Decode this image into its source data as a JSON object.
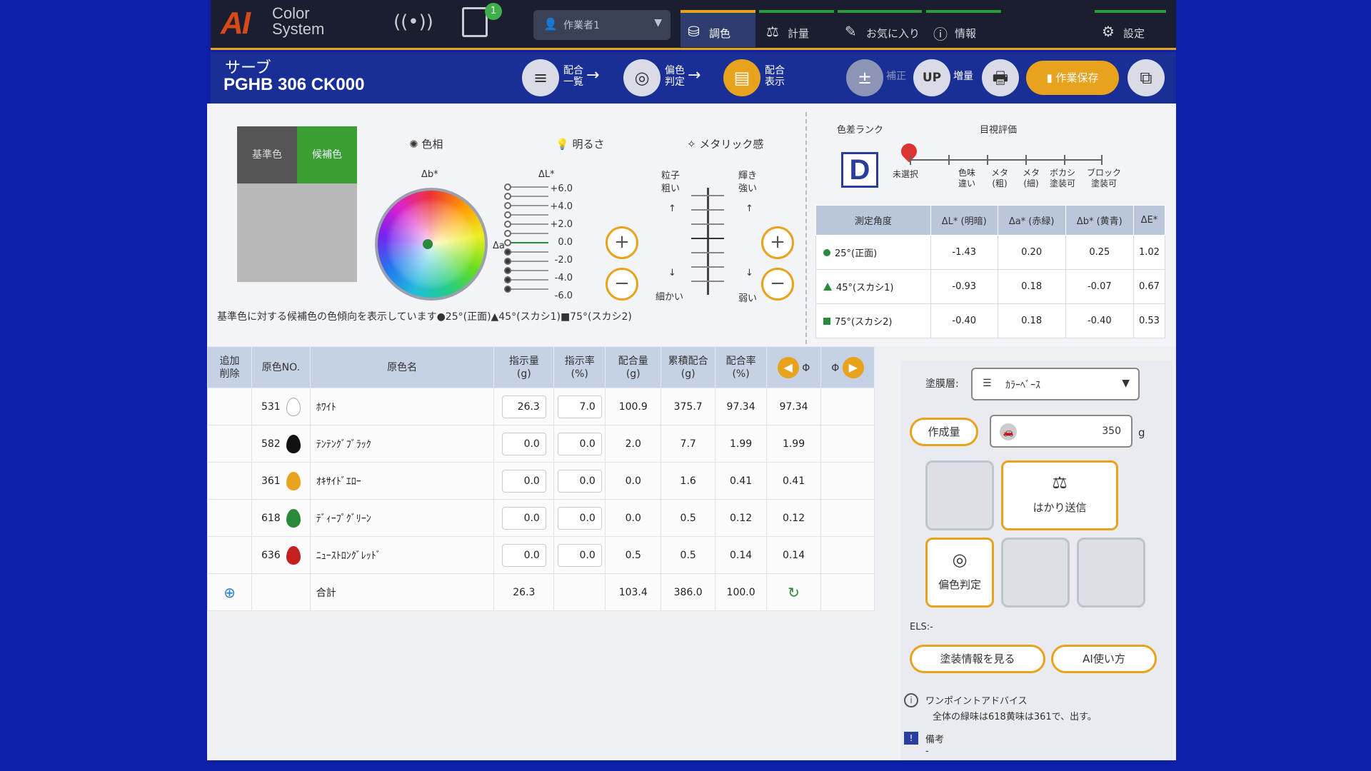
{
  "header": {
    "logo_ai": "AI",
    "logo_line1": "Color",
    "logo_line2": "System",
    "pc_badge": "1",
    "user_select": "作業者1",
    "tabs": [
      {
        "label": "調色",
        "icon": "mixing-icon"
      },
      {
        "label": "計量",
        "icon": "scale-icon"
      },
      {
        "label": "お気に入り",
        "icon": "favorite-icon"
      },
      {
        "label": "情報",
        "icon": "info-icon"
      },
      {
        "label": "設定",
        "icon": "gear-icon"
      }
    ]
  },
  "subheader": {
    "car_name": "サーブ",
    "color_code": "PGHB 306 CK000",
    "steps": [
      {
        "line1": "配合",
        "line2": "一覧"
      },
      {
        "line1": "偏色",
        "line2": "判定"
      },
      {
        "line1": "配合",
        "line2": "表示"
      }
    ],
    "correct_label": "補正",
    "increase_label": "増量",
    "up_label": "UP",
    "save_label": "作業保存"
  },
  "swatch": {
    "base_label": "基準色",
    "candidate_label": "候補色"
  },
  "sections": {
    "hue": "色相",
    "lightness": "明るさ",
    "metallic": "メタリック感",
    "delta_b": "Δb*",
    "delta_a": "Δa*",
    "delta_l": "ΔL*"
  },
  "lightness_scale": [
    "+6.0",
    "+4.0",
    "+2.0",
    "0.0",
    "-2.0",
    "-4.0",
    "-6.0"
  ],
  "metallic": {
    "grain_label": "粒子",
    "coarse": "粗い",
    "fine": "細かい",
    "shine_label": "輝き",
    "strong": "強い",
    "weak": "弱い",
    "up_arrow": "↑",
    "down_arrow": "↓"
  },
  "note": "基準色に対する候補色の色傾向を表示しています●25°(正面)▲45°(スカシ1)■75°(スカシ2)",
  "rank": {
    "title": "色差ランク",
    "value": "D",
    "eval_title": "目視評価",
    "unselected": "未選択",
    "options": [
      {
        "line1": "色味",
        "line2": "違い"
      },
      {
        "line1": "メタ",
        "line2": "(粗)"
      },
      {
        "line1": "メタ",
        "line2": "(細)"
      },
      {
        "line1": "ボカシ",
        "line2": "塗装可"
      },
      {
        "line1": "ブロック",
        "line2": "塗装可"
      }
    ]
  },
  "delta_table": {
    "headers": [
      "測定角度",
      "ΔL* (明暗)",
      "Δa* (赤緑)",
      "Δb* (黄青)",
      "ΔE*"
    ],
    "rows": [
      {
        "angle": "25°(正面)",
        "marker": "circle",
        "dl": "-1.43",
        "da": "0.20",
        "db": "0.25",
        "de": "1.02"
      },
      {
        "angle": "45°(スカシ1)",
        "marker": "triangle",
        "dl": "-0.93",
        "da": "0.18",
        "db": "-0.07",
        "de": "0.67"
      },
      {
        "angle": "75°(スカシ2)",
        "marker": "square",
        "dl": "-0.40",
        "da": "0.18",
        "db": "-0.40",
        "de": "0.53"
      }
    ]
  },
  "recipe": {
    "headers": {
      "add_del_1": "追加",
      "add_del_2": "削除",
      "code": "原色NO.",
      "name": "原色名",
      "instr_amt_1": "指示量",
      "instr_amt_2": "(g)",
      "instr_rate_1": "指示率",
      "instr_rate_2": "(%)",
      "mix_amt_1": "配合量",
      "mix_amt_2": "(g)",
      "cum_1": "累積配合",
      "cum_2": "(g)",
      "mix_rate_1": "配合率",
      "mix_rate_2": "(%)",
      "pct_sym": "Φ"
    },
    "rows": [
      {
        "code": "531",
        "color": "#ffffff",
        "name": "ﾎﾜｲﾄ",
        "instr_amt": "26.3",
        "instr_rate": "7.0",
        "mix_amt": "100.9",
        "cum": "375.7",
        "mix_rate": "97.34",
        "mix_rate2": "97.34"
      },
      {
        "code": "582",
        "color": "#111111",
        "name": "ﾃﾝﾃﾝｸﾞﾌﾞﾗｯｸ",
        "instr_amt": "0.0",
        "instr_rate": "0.0",
        "mix_amt": "2.0",
        "cum": "7.7",
        "mix_rate": "1.99",
        "mix_rate2": "1.99"
      },
      {
        "code": "361",
        "color": "#e8a21c",
        "name": "ｵｷｻｲﾄﾞｴﾛｰ",
        "instr_amt": "0.0",
        "instr_rate": "0.0",
        "mix_amt": "0.0",
        "cum": "1.6",
        "mix_rate": "0.41",
        "mix_rate2": "0.41"
      },
      {
        "code": "618",
        "color": "#2a8a3a",
        "name": "ﾃﾞｨｰﾌﾟｸﾞﾘｰﾝ",
        "instr_amt": "0.0",
        "instr_rate": "0.0",
        "mix_amt": "0.0",
        "cum": "0.5",
        "mix_rate": "0.12",
        "mix_rate2": "0.12"
      },
      {
        "code": "636",
        "color": "#c42020",
        "name": "ﾆｭｰｽﾄﾛﾝｸﾞﾚｯﾄﾞ",
        "instr_amt": "0.0",
        "instr_rate": "0.0",
        "mix_amt": "0.5",
        "cum": "0.5",
        "mix_rate": "0.14",
        "mix_rate2": "0.14"
      }
    ],
    "total": {
      "label": "合計",
      "instr_amt": "26.3",
      "mix_amt": "103.4",
      "cum": "386.0",
      "mix_rate": "100.0"
    }
  },
  "right": {
    "layer_label": "塗膜層:",
    "layer_value": "ｶﾗｰﾍﾞｰｽ",
    "amount_label": "作成量",
    "amount_value": "350",
    "unit": "g",
    "scale_send": "はかり送信",
    "bias_judge": "偏色判定",
    "els": "ELS:-",
    "paint_info": "塗装情報を見る",
    "ai_howto": "AI使い方",
    "advice_title": "ワンポイントアドバイス",
    "advice_text": "全体の緑味は618黄味は361で、出す。",
    "remarks": "備考",
    "remarks_value": "-"
  },
  "colors": {
    "accent": "#e8a21c",
    "navy": "#1a2f96",
    "green": "#2a8a3a"
  }
}
